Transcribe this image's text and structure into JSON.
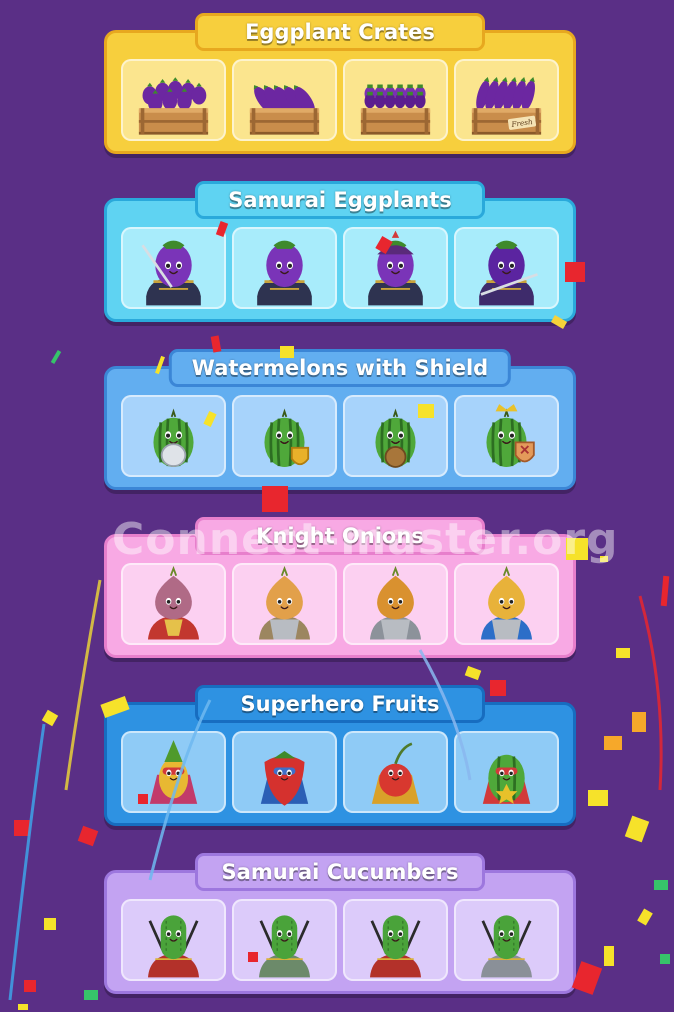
{
  "groups": [
    {
      "title": "Eggplant Crates",
      "fill": "#f7cf3d",
      "frame": "#e7a81f",
      "tile": "#fbe58e",
      "kind": "crate"
    },
    {
      "title": "Samurai Eggplants",
      "fill": "#5fd3f2",
      "frame": "#2aa9db",
      "tile": "#a8ecfb",
      "kind": "samurai-eggplant"
    },
    {
      "title": "Watermelons with Shield",
      "fill": "#62aef0",
      "frame": "#3b86d6",
      "tile": "#a7d3fb",
      "kind": "watermelon"
    },
    {
      "title": "Knight Onions",
      "fill": "#f8a9e4",
      "frame": "#e77fcc",
      "tile": "#fcd0f1",
      "kind": "onion"
    },
    {
      "title": "Superhero Fruits",
      "fill": "#2e92e2",
      "frame": "#176dc0",
      "tile": "#8fcbf6",
      "kind": "superhero"
    },
    {
      "title": "Samurai Cucumbers",
      "fill": "#c3a3f2",
      "frame": "#9d77de",
      "tile": "#dccbfa",
      "kind": "cucumber"
    }
  ],
  "crate_label": "Fresh",
  "watermark": "Connect-master.org"
}
